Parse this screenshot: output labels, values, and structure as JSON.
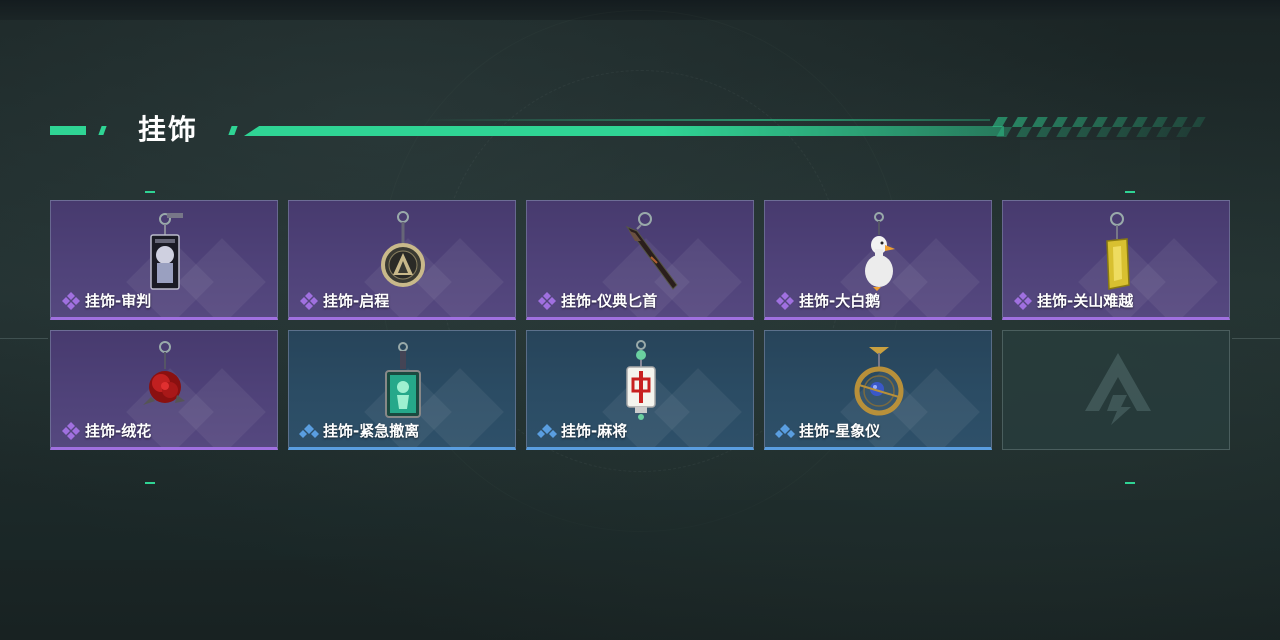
{
  "header": {
    "title": "挂饰"
  },
  "rarity_colors": {
    "epic": "#a070e0",
    "rare": "#5a9ee0"
  },
  "accent_color": "#2fd494",
  "items": [
    {
      "name": "挂饰-审判",
      "rarity": "epic",
      "icon": "judgment-card-pendant-icon"
    },
    {
      "name": "挂饰-启程",
      "rarity": "epic",
      "icon": "departure-ring-pendant-icon"
    },
    {
      "name": "挂饰-仪典匕首",
      "rarity": "epic",
      "icon": "ceremonial-dagger-pendant-icon"
    },
    {
      "name": "挂饰-大白鹅",
      "rarity": "epic",
      "icon": "white-goose-pendant-icon"
    },
    {
      "name": "挂饰-关山难越",
      "rarity": "epic",
      "icon": "gold-bar-pendant-icon"
    },
    {
      "name": "挂饰-绒花",
      "rarity": "epic",
      "icon": "red-rose-pendant-icon"
    },
    {
      "name": "挂饰-紧急撤离",
      "rarity": "rare",
      "icon": "emergency-exit-sign-pendant-icon"
    },
    {
      "name": "挂饰-麻将",
      "rarity": "rare",
      "icon": "mahjong-tile-pendant-icon"
    },
    {
      "name": "挂饰-星象仪",
      "rarity": "rare",
      "icon": "astrolabe-pendant-icon"
    }
  ],
  "empty_slot": {
    "icon": "game-logo-icon"
  }
}
